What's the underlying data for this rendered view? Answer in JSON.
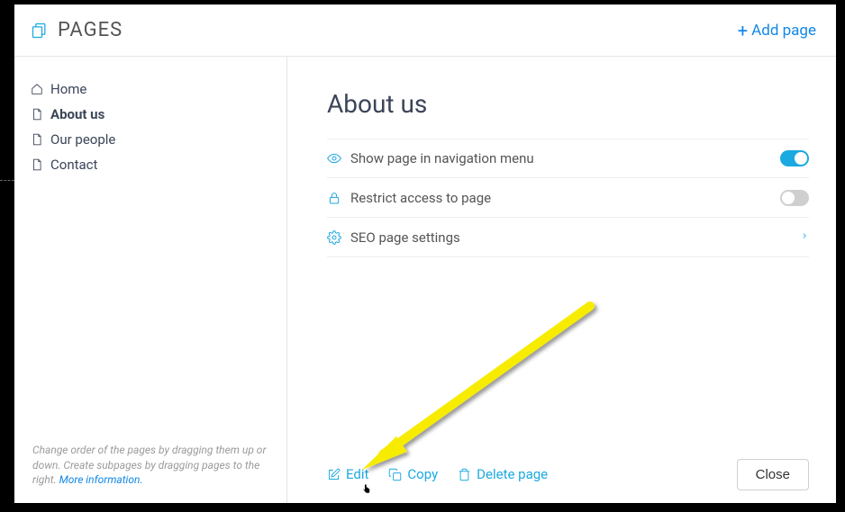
{
  "header": {
    "title": "PAGES",
    "add_label": "Add page"
  },
  "sidebar": {
    "items": [
      {
        "label": "Home",
        "icon": "home-icon",
        "active": false
      },
      {
        "label": "About us",
        "icon": "page-icon",
        "active": true
      },
      {
        "label": "Our people",
        "icon": "page-icon",
        "active": false
      },
      {
        "label": "Contact",
        "icon": "page-icon",
        "active": false
      }
    ],
    "help_text": "Change order of the pages by dragging them up or down. Create subpages by dragging pages to the right. ",
    "help_link": "More information."
  },
  "main": {
    "title": "About us",
    "settings": {
      "show_in_nav": {
        "label": "Show page in navigation menu",
        "on": true
      },
      "restrict": {
        "label": "Restrict access to page",
        "on": false
      },
      "seo": {
        "label": "SEO page settings"
      }
    },
    "actions": {
      "edit": "Edit",
      "copy": "Copy",
      "delete": "Delete page",
      "close": "Close"
    }
  }
}
